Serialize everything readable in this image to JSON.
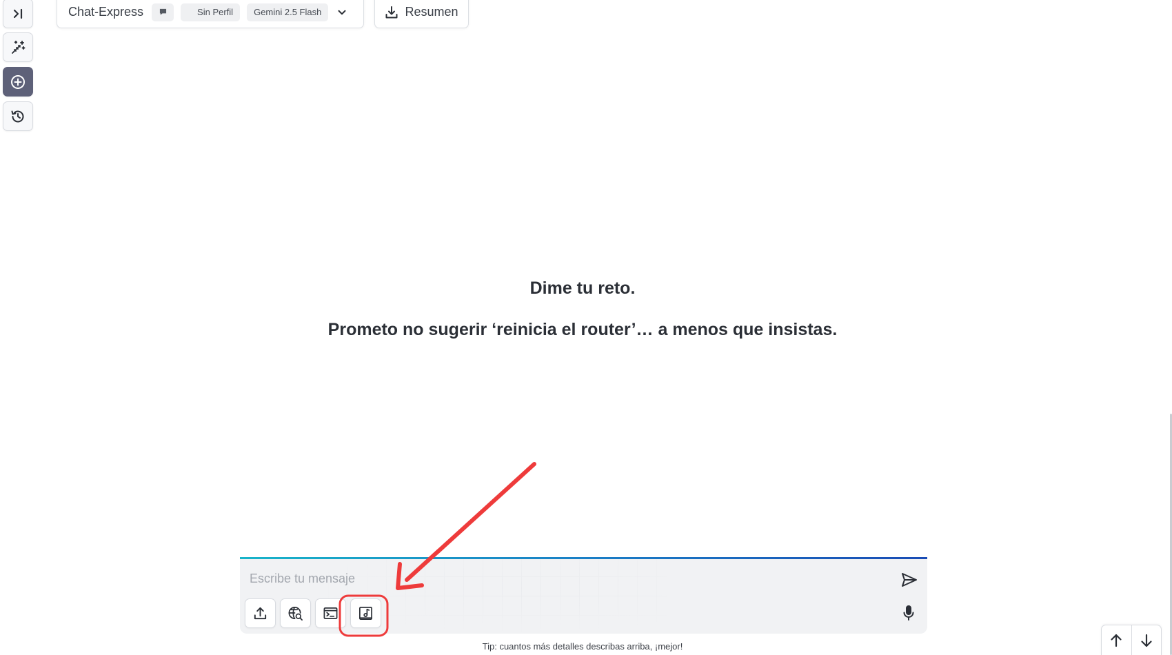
{
  "header": {
    "title": "Chat-Express",
    "profile_label": "Sin Perfil",
    "model_label": "Gemini 2.5 Flash",
    "summary_label": "Resumen"
  },
  "hero": {
    "line1": "Dime tu reto.",
    "line2": "Prometo no sugerir ‘reinicia el router’… a menos que insistas."
  },
  "composer": {
    "placeholder": "Escribe tu mensaje",
    "value": ""
  },
  "tip": "Tip: cuantos más detalles describas arriba, ¡mejor!",
  "icons": {
    "rail": [
      "expand-sidebar-icon",
      "magic-wand-icon",
      "new-chat-icon",
      "history-icon"
    ],
    "tools": [
      "upload-icon",
      "web-search-icon",
      "terminal-icon",
      "music-icon"
    ],
    "other": [
      "chat-bubble-icon",
      "chevron-down-icon",
      "download-icon",
      "send-icon",
      "microphone-icon",
      "arrow-up-icon",
      "arrow-down-icon"
    ]
  },
  "colors": {
    "accent_gradient_start": "#18b4c9",
    "accent_gradient_end": "#1a4cb5",
    "active_rail": "#5e6179",
    "annotation": "#ee3b3b"
  }
}
